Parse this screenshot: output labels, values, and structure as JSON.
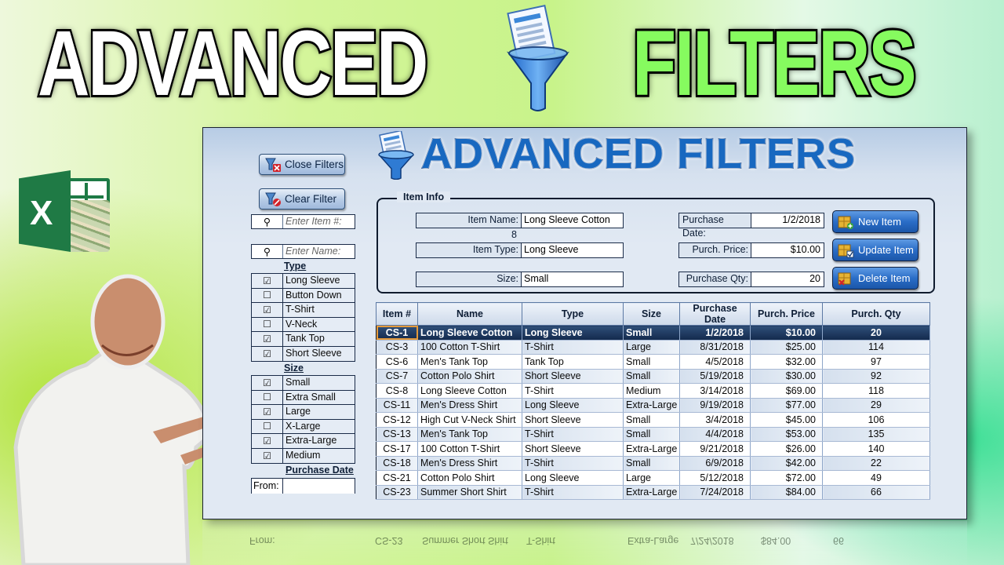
{
  "thumbnail": {
    "headline_left": "ADVANCED",
    "headline_right": "FILTERS",
    "colors": {
      "headline_left": "#ffffff",
      "headline_right": "#86fb5f",
      "app_title": "#1868c0",
      "selected_row": "#1b3560"
    }
  },
  "app": {
    "title": "ADVANCED FILTERS",
    "buttons": {
      "close_filters": "Close Filters",
      "clear_filter": "Clear Filter",
      "new_item": "New Item",
      "update_item": "Update Item",
      "delete_item": "Delete Item"
    },
    "filters": {
      "item_number_placeholder": "Enter Item #:",
      "name_placeholder": "Enter Name:",
      "type_label": "Type",
      "types": [
        {
          "label": "Long Sleeve",
          "checked": true,
          "mark": "☑"
        },
        {
          "label": "Button Down",
          "checked": false,
          "mark": "☐"
        },
        {
          "label": "T-Shirt",
          "checked": true,
          "mark": "☑"
        },
        {
          "label": "V-Neck",
          "checked": false,
          "mark": "☐"
        },
        {
          "label": "Tank Top",
          "checked": true,
          "mark": "☑"
        },
        {
          "label": "Short Sleeve",
          "checked": true,
          "mark": "☑"
        }
      ],
      "size_label": "Size",
      "sizes": [
        {
          "label": "Small",
          "checked": true,
          "mark": "☑"
        },
        {
          "label": "Extra Small",
          "checked": false,
          "mark": "☐"
        },
        {
          "label": "Large",
          "checked": true,
          "mark": "☑"
        },
        {
          "label": "X-Large",
          "checked": false,
          "mark": "☐"
        },
        {
          "label": "Extra-Large",
          "checked": true,
          "mark": "☑"
        },
        {
          "label": "Medium",
          "checked": true,
          "mark": "☑"
        }
      ],
      "purchase_date_label": "Purchase Date",
      "from_label": "From:",
      "from_value": ""
    },
    "item_info": {
      "legend": "Item Info",
      "item_name_label": "Item Name:",
      "item_name": "Long Sleeve Cotton",
      "row_counter": "8",
      "item_type_label": "Item Type:",
      "item_type": "Long Sleeve",
      "size_label": "Size:",
      "size": "Small",
      "purchase_date_label": "Purchase Date:",
      "purchase_date": "1/2/2018",
      "purch_price_label": "Purch. Price:",
      "purch_price": "$10.00",
      "purchase_qty_label": "Purchase Qty:",
      "purchase_qty": "20"
    },
    "table": {
      "columns": [
        "Item #",
        "Name",
        "Type",
        "Size",
        "Purchase Date",
        "Purch. Price",
        "Purch. Qty"
      ],
      "selected_index": 0,
      "rows": [
        [
          "CS-1",
          "Long Sleeve Cotton",
          "Long Sleeve",
          "Small",
          "1/2/2018",
          "$10.00",
          "20"
        ],
        [
          "CS-3",
          "100 Cotton T-Shirt",
          "T-Shirt",
          "Large",
          "8/31/2018",
          "$25.00",
          "114"
        ],
        [
          "CS-6",
          "Men's Tank Top",
          "Tank Top",
          "Small",
          "4/5/2018",
          "$32.00",
          "97"
        ],
        [
          "CS-7",
          "Cotton Polo Shirt",
          "Short Sleeve",
          "Small",
          "5/19/2018",
          "$30.00",
          "92"
        ],
        [
          "CS-8",
          "Long Sleeve Cotton",
          "T-Shirt",
          "Medium",
          "3/14/2018",
          "$69.00",
          "118"
        ],
        [
          "CS-11",
          "Men's Dress Shirt",
          "Long Sleeve",
          "Extra-Large",
          "9/19/2018",
          "$77.00",
          "29"
        ],
        [
          "CS-12",
          "High Cut V-Neck Shirt",
          "Short Sleeve",
          "Small",
          "3/4/2018",
          "$45.00",
          "106"
        ],
        [
          "CS-13",
          "Men's Tank Top",
          "T-Shirt",
          "Small",
          "4/4/2018",
          "$53.00",
          "135"
        ],
        [
          "CS-17",
          "100 Cotton T-Shirt",
          "Short Sleeve",
          "Extra-Large",
          "9/21/2018",
          "$26.00",
          "140"
        ],
        [
          "CS-18",
          "Men's Dress Shirt",
          "T-Shirt",
          "Small",
          "6/9/2018",
          "$42.00",
          "22"
        ],
        [
          "CS-21",
          "Cotton Polo Shirt",
          "Long Sleeve",
          "Large",
          "5/12/2018",
          "$72.00",
          "49"
        ],
        [
          "CS-23",
          "Summer Short Shirt",
          "T-Shirt",
          "Extra-Large",
          "7/24/2018",
          "$84.00",
          "66"
        ]
      ]
    }
  }
}
